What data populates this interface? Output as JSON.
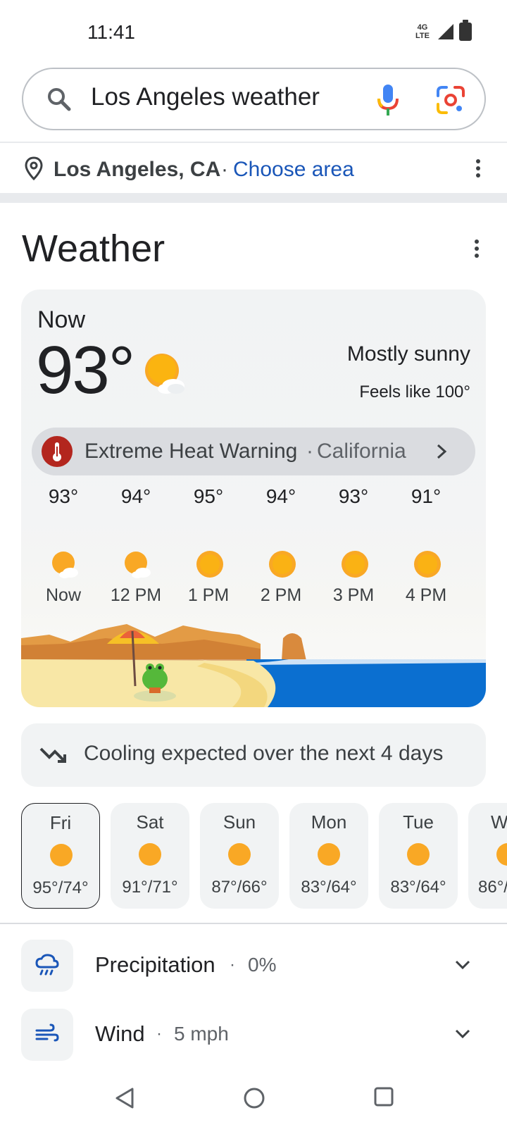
{
  "status_bar": {
    "time": "11:41",
    "network_label": "4G LTE"
  },
  "search": {
    "query": "Los Angeles weather"
  },
  "location": {
    "name": "Los Angeles, CA",
    "separator": "·",
    "choose_area": "Choose area"
  },
  "weather": {
    "title": "Weather",
    "now_label": "Now",
    "current_temp": "93°",
    "condition": "Mostly sunny",
    "feels_like": "Feels like 100°",
    "alert": {
      "title": "Extreme Heat Warning",
      "separator": "·",
      "region": "California"
    },
    "hourly": [
      {
        "temp": "93°",
        "time": "Now",
        "icon": "partly-sunny-icon"
      },
      {
        "temp": "94°",
        "time": "12 PM",
        "icon": "partly-sunny-icon"
      },
      {
        "temp": "95°",
        "time": "1 PM",
        "icon": "sunny-icon"
      },
      {
        "temp": "94°",
        "time": "2 PM",
        "icon": "sunny-icon"
      },
      {
        "temp": "93°",
        "time": "3 PM",
        "icon": "sunny-icon"
      },
      {
        "temp": "91°",
        "time": "4 PM",
        "icon": "sunny-icon"
      }
    ],
    "trend_text": "Cooling expected over the next 4 days",
    "daily": [
      {
        "day": "Fri",
        "range": "95°/74°",
        "selected": true
      },
      {
        "day": "Sat",
        "range": "91°/71°"
      },
      {
        "day": "Sun",
        "range": "87°/66°"
      },
      {
        "day": "Mon",
        "range": "83°/64°"
      },
      {
        "day": "Tue",
        "range": "83°/64°"
      },
      {
        "day": "W",
        "range": "86°/"
      }
    ],
    "precipitation": {
      "label": "Precipitation",
      "separator": "·",
      "value": "0%"
    },
    "wind": {
      "label": "Wind",
      "separator": "·",
      "value": "5 mph"
    }
  },
  "colors": {
    "sun": "#f9a825",
    "accent_blue": "#1a56b8",
    "alert_red": "#b3261e",
    "card_bg": "#f1f3f4"
  }
}
